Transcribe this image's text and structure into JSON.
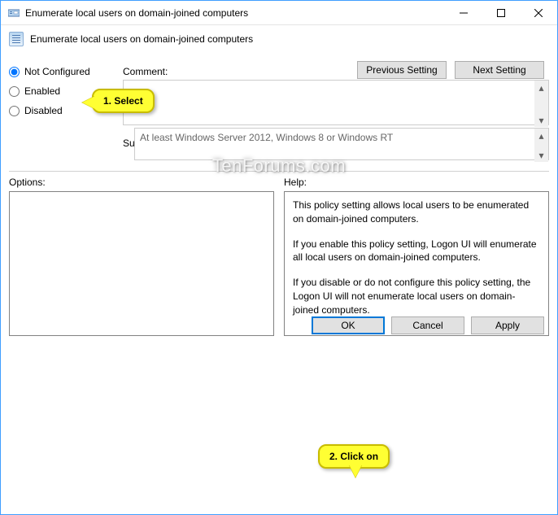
{
  "titlebar": {
    "title": "Enumerate local users on domain-joined computers"
  },
  "header": {
    "title": "Enumerate local users on domain-joined computers"
  },
  "nav": {
    "prev": "Previous Setting",
    "next": "Next Setting"
  },
  "radios": {
    "not_configured": "Not Configured",
    "enabled": "Enabled",
    "disabled": "Disabled"
  },
  "labels": {
    "comment": "Comment:",
    "supported": "Supported on:",
    "options": "Options:",
    "help": "Help:"
  },
  "supported_text": "At least Windows Server 2012, Windows 8 or Windows RT",
  "help": {
    "p1": "This policy setting allows local users to be enumerated on domain-joined computers.",
    "p2": "If you enable this policy setting, Logon UI will enumerate all local users on domain-joined computers.",
    "p3": "If you disable or do not configure this policy setting, the Logon UI will not enumerate local users on domain-joined computers."
  },
  "footer": {
    "ok": "OK",
    "cancel": "Cancel",
    "apply": "Apply"
  },
  "callouts": {
    "c1": "1. Select",
    "c2": "2. Click on"
  },
  "watermark": "TenForums.com"
}
